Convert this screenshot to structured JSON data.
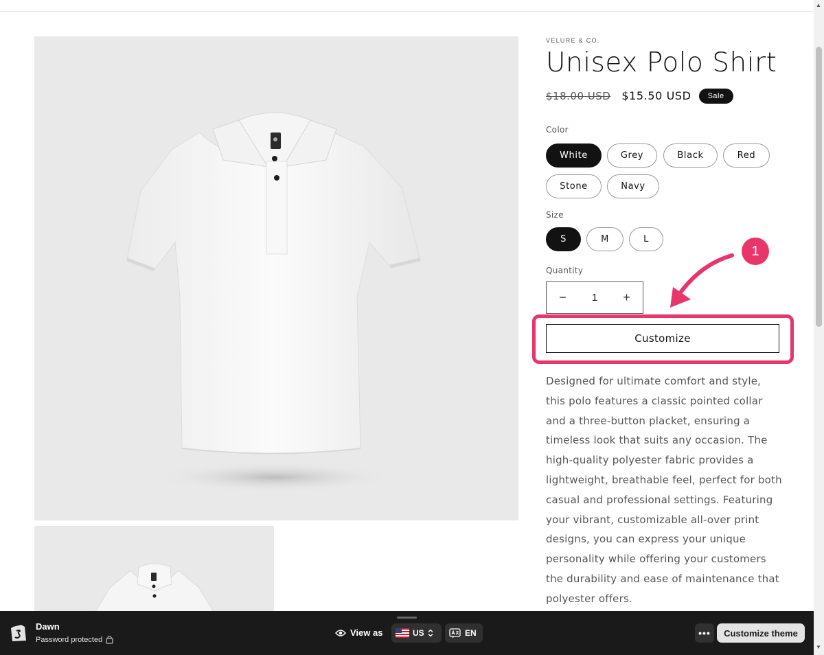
{
  "product": {
    "vendor": "VELURE & CO.",
    "title": "Unisex Polo Shirt",
    "price_old": "$18.00 USD",
    "price_new": "$15.50 USD",
    "badge": "Sale",
    "color_label": "Color",
    "colors": [
      "White",
      "Grey",
      "Black",
      "Red",
      "Stone",
      "Navy"
    ],
    "selected_color": "White",
    "size_label": "Size",
    "sizes": [
      "S",
      "M",
      "L"
    ],
    "selected_size": "S",
    "quantity_label": "Quantity",
    "quantity": "1",
    "qty_minus": "−",
    "qty_plus": "+",
    "customize_label": "Customize",
    "description": "Designed for ultimate comfort and style, this polo features a classic pointed collar and a three-button placket, ensuring a timeless look that suits any occasion. The high-quality polyester fabric provides a lightweight, breathable feel, perfect for both casual and professional settings. Featuring your vibrant, customizable all-over print designs, you can express your unique personality while offering your customers the durability and ease of maintenance that polyester offers."
  },
  "annotation": {
    "step": "1",
    "accent": "#e8366b"
  },
  "preview_bar": {
    "theme_name": "Dawn",
    "status": "Password protected",
    "view_as": "View as",
    "country": "US",
    "language": "EN",
    "more": "•••",
    "customize_theme": "Customize theme"
  },
  "icons": [
    "shopify-logo-icon",
    "lock-icon",
    "eye-icon",
    "us-flag-icon",
    "chevron-updown-icon",
    "translate-icon",
    "more-icon",
    "curved-arrow-icon"
  ]
}
